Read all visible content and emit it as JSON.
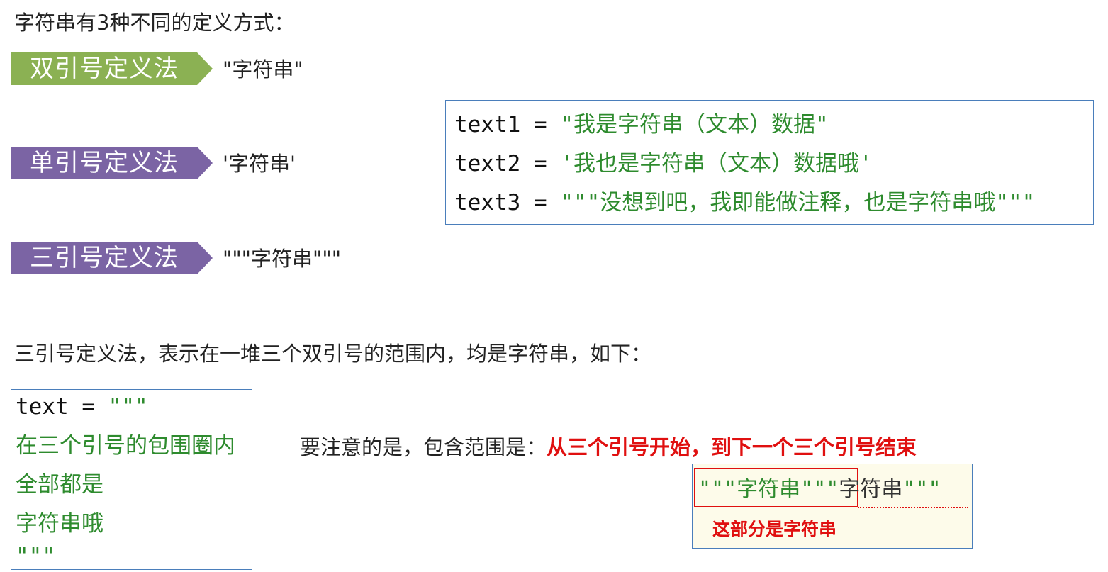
{
  "intro": "字符串有3种不同的定义方式：",
  "methods": [
    {
      "label": "双引号定义法",
      "example": "\"字符串\"",
      "color": "#8bb153"
    },
    {
      "label": "单引号定义法",
      "example": "'字符串'",
      "color": "#7b64a4"
    },
    {
      "label": "三引号定义法",
      "example": "\"\"\"字符串\"\"\"",
      "color": "#7b64a4"
    }
  ],
  "code_examples": [
    {
      "name": "text1 = ",
      "value": "\"我是字符串（文本）数据\""
    },
    {
      "name": "text2 = ",
      "value": "'我也是字符串（文本）数据哦'"
    },
    {
      "name": "text3 = ",
      "value": "\"\"\"没想到吧，我即能做注释，也是字符串哦\"\"\""
    }
  ],
  "triple_note": "三引号定义法，表示在一堆三个双引号的范围内，均是字符串，如下：",
  "multiline_code": {
    "first_name": "text = ",
    "first_quote": "\"\"\"",
    "lines": [
      "在三个引号的包围圈内",
      "全部都是",
      "字符串哦"
    ],
    "close": "\"\"\""
  },
  "attention": {
    "prefix": "要注意的是，包含范围是：",
    "highlight": "从三个引号开始，到下一个三个引号结束"
  },
  "demo": {
    "open_quote": "\"\"\"",
    "content": "字符串",
    "close_quote": "\"\"\"",
    "trailing_text": "字符串",
    "trailing_quote": "\"\"\"",
    "label": "这部分是字符串"
  }
}
